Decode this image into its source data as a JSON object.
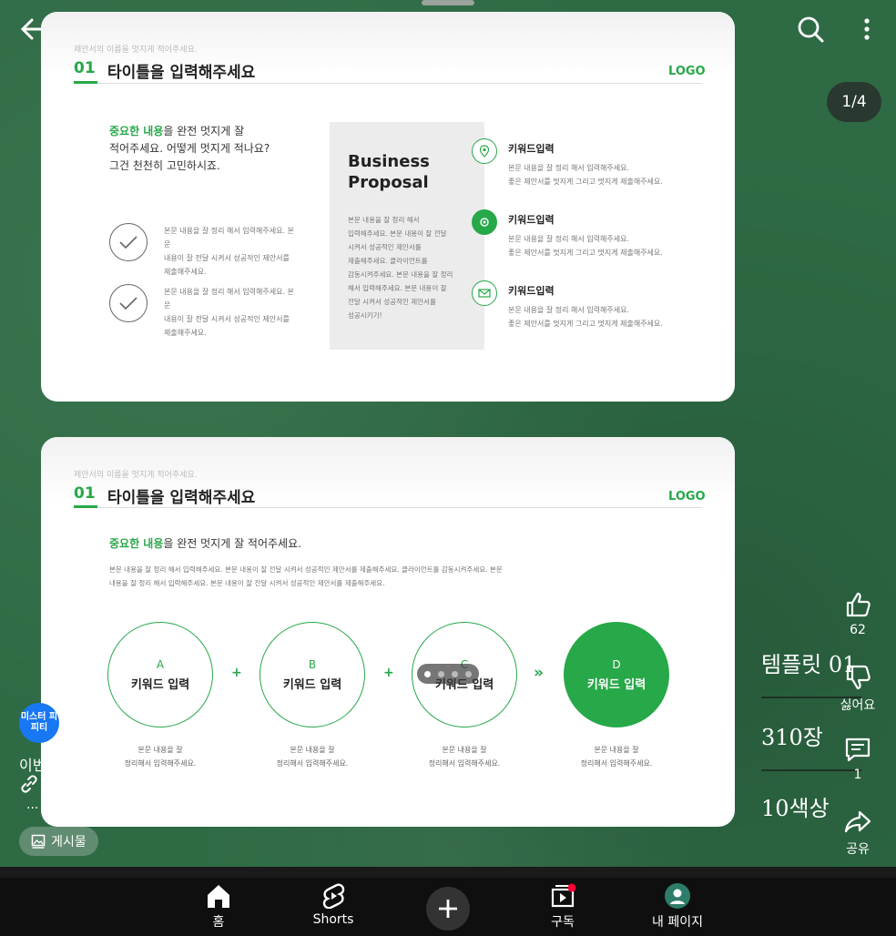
{
  "viewer": {
    "page_counter": "1/4"
  },
  "slide_common": {
    "supertitle": "제안서의 이름을 멋지게 적어주세요.",
    "number": "01",
    "title": "타이틀을 입력해주세요",
    "logo": "LOGO"
  },
  "slide1": {
    "lead_green": "중요한 내용",
    "lead_rest_1": "을 완전 멋지게 잘",
    "lead_line_2": "적어주세요. 어떻게 멋지게 적나요?",
    "lead_line_3": "그건 천천히 고민하시죠.",
    "check_items": [
      {
        "line1": "본문 내용을 잘 정리 해서 입력해주세요. 본문",
        "line2": "내용이 잘 전달 시켜서 성공적인 제안서를",
        "line3": "제출해주세요."
      },
      {
        "line1": "본문 내용을 잘 정리 해서 입력해주세요. 본문",
        "line2": "내용이 잘 전달 시켜서 성공적인 제안서를",
        "line3": "제출해주세요."
      }
    ],
    "box_title_1": "Business",
    "box_title_2": "Proposal",
    "box_body": [
      "본문 내용을 잘 정리 해서",
      "입력해주세요. 본문 내용이 잘 전달",
      "시켜서 성공적인 제안서를",
      "제출해주세요. 클라이언트를",
      "감동시켜주세요. 본문 내용을 잘 정리",
      "해서 입력해주세요. 본문 내용이 잘",
      "전달 시켜서 성공적인 제안서를",
      "성공시키기!"
    ],
    "keywords": [
      {
        "title": "키워드입력",
        "line1": "본문 내용을 잘 정리 해서 입력해주세요.",
        "line2": "좋은 제안서를 멋지게 그리고 멋지게 제출해주세요."
      },
      {
        "title": "키워드입력",
        "line1": "본문 내용을 잘 정리 해서 입력해주세요.",
        "line2": "좋은 제안서를 멋지게 그리고 멋지게 제출해주세요."
      },
      {
        "title": "키워드입력",
        "line1": "본문 내용을 잘 정리 해서 입력해주세요.",
        "line2": "좋은 제안서를 멋지게 그리고 멋지게 제출해주세요."
      }
    ]
  },
  "slide2": {
    "lead_green": "중요한 내용",
    "lead_rest": "을 완전 멋지게 잘 적어주세요.",
    "body_line1": "본문 내용을 잘 정리 해서 입력해주세요. 본문 내용이 잘 전달 시켜서 성공적인 제안서를 제출해주세요. 클라이언트를 감동시켜주세요. 본문",
    "body_line2": "내용을 잘 정리 해서 입력해주세요. 본문 내용이 잘 전달 시켜서 성공적인 제안서를 제출해주세요.",
    "steps": [
      {
        "letter": "A",
        "keyword": "키워드 입력",
        "cap1": "본문 내용을 잘",
        "cap2": "정리해서 입력해주세요."
      },
      {
        "letter": "B",
        "keyword": "키워드 입력",
        "cap1": "본문 내용을 잘",
        "cap2": "정리해서 입력해주세요."
      },
      {
        "letter": "C",
        "keyword": "키워드 입력",
        "cap1": "본문 내용을 잘",
        "cap2": "정리해서 입력해주세요."
      },
      {
        "letter": "D",
        "keyword": "키워드 입력",
        "cap1": "본문 내용을 잘",
        "cap2": "정리해서 입력해주세요."
      }
    ],
    "plus": "+",
    "arrow": "»"
  },
  "overlay": {
    "title": "템플릿 01",
    "count": "310장",
    "colors": "10색상"
  },
  "actions": {
    "like_count": "62",
    "dislike_label": "싫어요",
    "comment_count": "1",
    "share_label": "공유"
  },
  "channel": {
    "avatar_text": "미스터 피피티",
    "name_partial": "이번",
    "more": "..."
  },
  "post_chip": {
    "label": "게시물"
  },
  "nav": {
    "home": "홈",
    "shorts": "Shorts",
    "subscriptions": "구독",
    "my_page": "내 페이지"
  },
  "colors": {
    "accent_green": "#27a849",
    "background_green": "#2e6b45",
    "nav_bg": "#0f0f0f"
  }
}
